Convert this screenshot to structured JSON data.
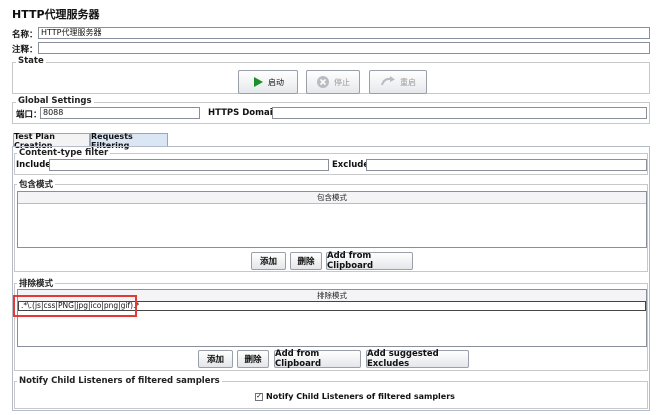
{
  "title": "HTTP代理服务器",
  "name_label": "名称：",
  "name_value": "HTTP代理服务器",
  "comment_label": "注释：",
  "comment_value": "",
  "state": {
    "legend": "State",
    "start_label": "启动",
    "stop_label": "停止",
    "restart_label": "重启"
  },
  "global": {
    "legend": "Global Settings",
    "port_label": "端口：",
    "port_value": "8088",
    "https_label": "HTTPS Domains :",
    "https_value": ""
  },
  "tabs": [
    {
      "label": "Test Plan Creation",
      "active": false
    },
    {
      "label": "Requests Filtering",
      "active": true
    }
  ],
  "content_filter": {
    "legend": "Content-type filter",
    "include_label": "Include:",
    "include_value": "",
    "exclude_label": "Exclude:",
    "exclude_value": ""
  },
  "include_patterns": {
    "legend": "包含模式",
    "column": "包含模式",
    "rows": [],
    "buttons": [
      "添加",
      "删除",
      "Add from Clipboard"
    ]
  },
  "exclude_patterns": {
    "legend": "排除模式",
    "column": "排除模式",
    "rows": [
      ".*\\.(js|css|PNG|jpg|ico|png|gif).*"
    ],
    "buttons": [
      "添加",
      "删除",
      "Add from Clipboard",
      "Add suggested Excludes"
    ]
  },
  "notify": {
    "legend": "Notify Child Listeners of filtered samplers",
    "checkbox_label": "Notify Child Listeners of filtered samplers",
    "checked": true
  },
  "colors": {
    "highlight_box": "#e53935",
    "start_arrow": "#1e8f2a",
    "active_tab": "#dbe6f5"
  }
}
